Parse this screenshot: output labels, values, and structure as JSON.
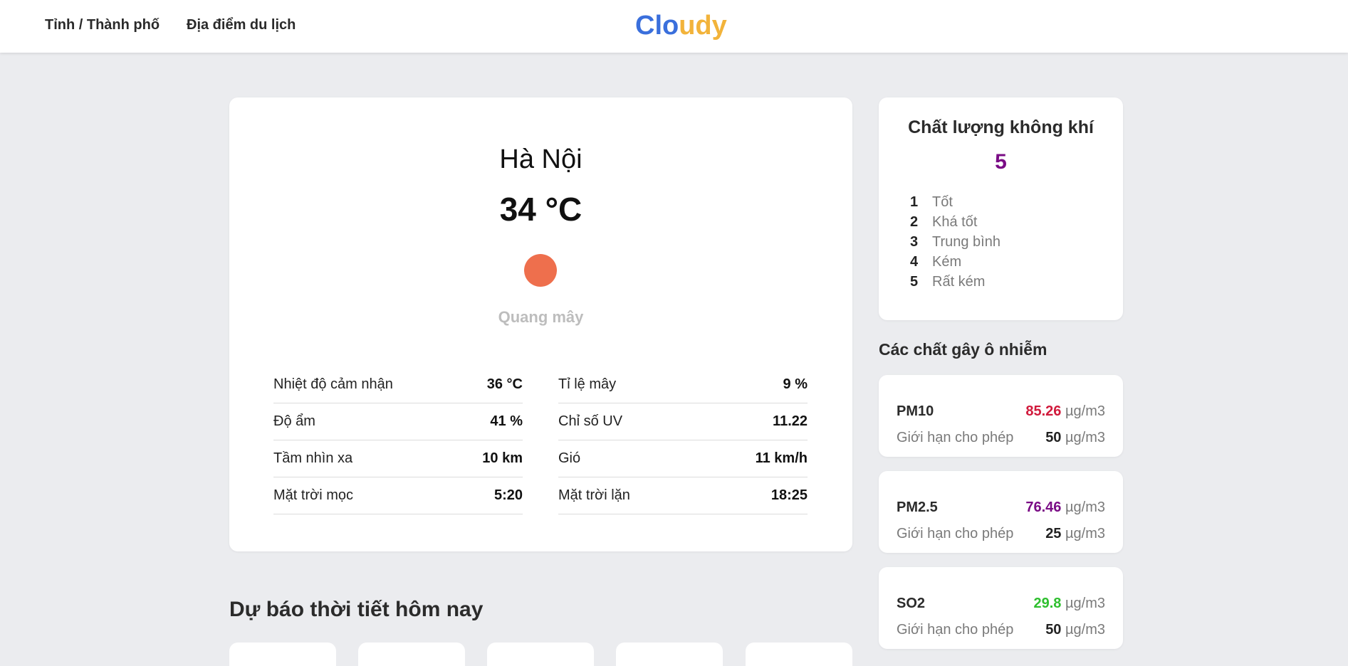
{
  "header": {
    "nav": [
      "Tỉnh / Thành phố",
      "Địa điểm du lịch"
    ],
    "logo_part1": "Clo",
    "logo_part2": "udy"
  },
  "weather": {
    "city": "Hà Nội",
    "temperature": "34 °C",
    "condition": "Quang mây",
    "icon": "sun-icon",
    "left_stats": [
      {
        "label": "Nhiệt độ cảm nhận",
        "value": "36 °C"
      },
      {
        "label": "Độ ẩm",
        "value": "41 %"
      },
      {
        "label": "Tầm nhìn xa",
        "value": "10 km"
      },
      {
        "label": "Mặt trời mọc",
        "value": "5:20"
      }
    ],
    "right_stats": [
      {
        "label": "Tỉ lệ mây",
        "value": "9 %"
      },
      {
        "label": "Chỉ số UV",
        "value": "11.22"
      },
      {
        "label": "Gió",
        "value": "11 km/h"
      },
      {
        "label": "Mặt trời lặn",
        "value": "18:25"
      }
    ]
  },
  "forecast": {
    "title": "Dự báo thời tiết hôm nay"
  },
  "aqi": {
    "title": "Chất lượng không khí",
    "value": "5",
    "value_color": "#7a0c85",
    "legend": [
      {
        "num": "1",
        "text": "Tốt"
      },
      {
        "num": "2",
        "text": "Khá tốt"
      },
      {
        "num": "3",
        "text": "Trung bình"
      },
      {
        "num": "4",
        "text": "Kém"
      },
      {
        "num": "5",
        "text": "Rất kém"
      }
    ]
  },
  "pollutants": {
    "title": "Các chất gây ô nhiễm",
    "limit_label": "Giới hạn cho phép",
    "unit": "µg/m3",
    "items": [
      {
        "name": "PM10",
        "value": "85.26",
        "color": "#d11a3c",
        "limit": "50"
      },
      {
        "name": "PM2.5",
        "value": "76.46",
        "color": "#7a0c85",
        "limit": "25"
      },
      {
        "name": "SO2",
        "value": "29.8",
        "color": "#2fbf2f",
        "limit": "50"
      }
    ]
  }
}
